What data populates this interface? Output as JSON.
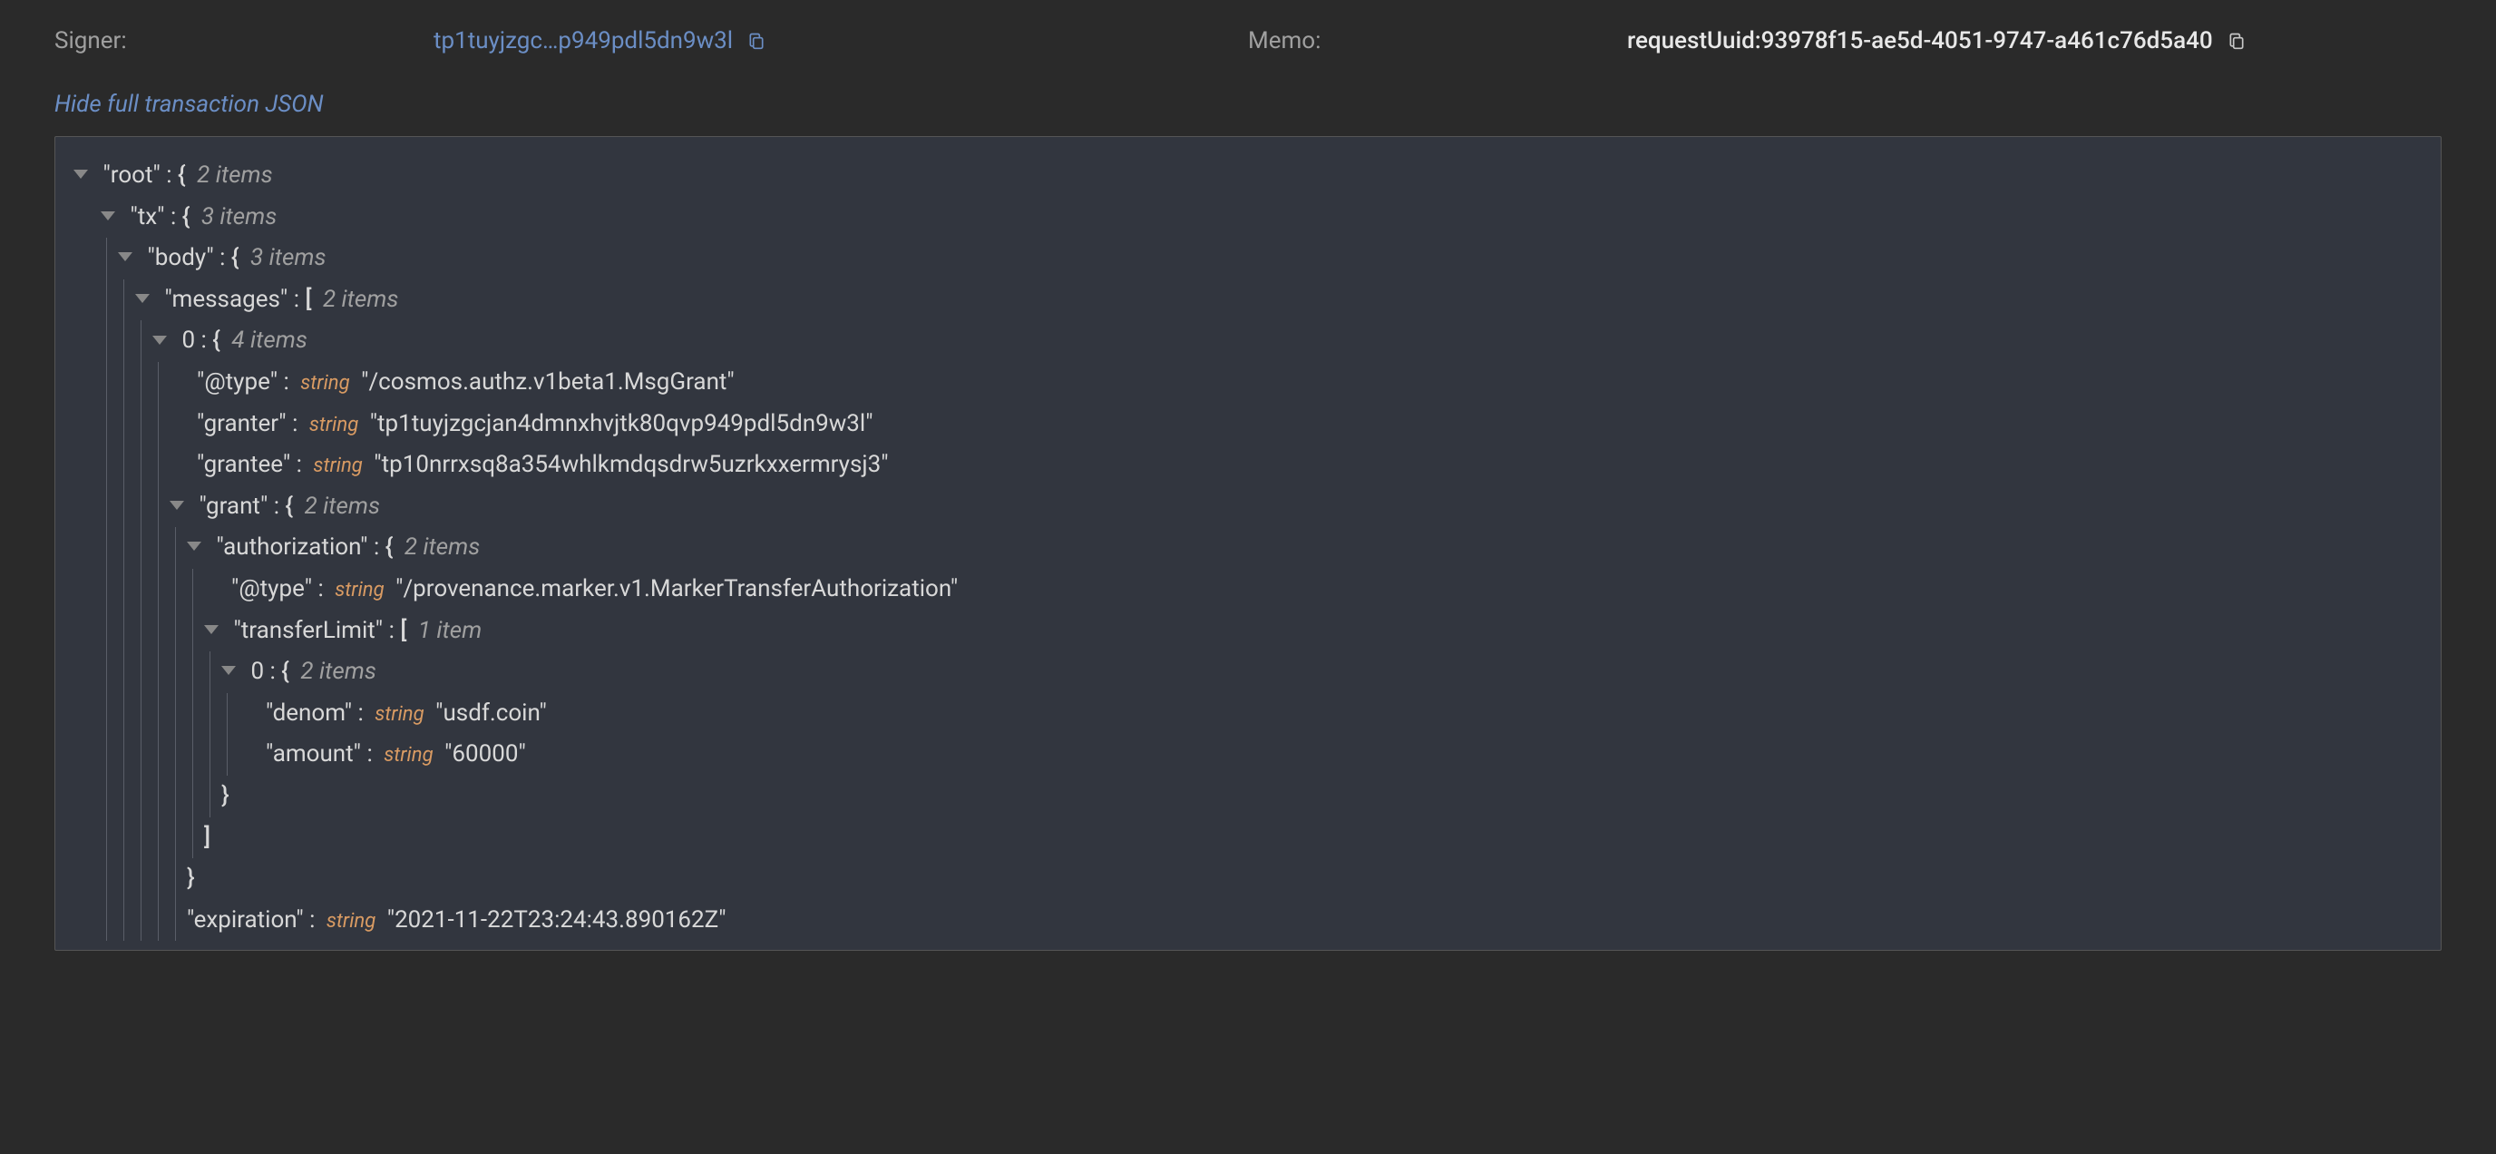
{
  "header": {
    "signer_label": "Signer:",
    "signer_value": "tp1tuyjzgc…p949pdl5dn9w3l",
    "memo_label": "Memo:",
    "memo_value": "requestUuid:93978f15-ae5d-4051-9747-a461c76d5a40"
  },
  "toggle": {
    "hide_label": "Hide full transaction JSON"
  },
  "json": {
    "root_key": "\"root\"",
    "root_meta": "2 items",
    "tx_key": "\"tx\"",
    "tx_meta": "3 items",
    "body_key": "\"body\"",
    "body_meta": "3 items",
    "messages_key": "\"messages\"",
    "messages_meta": "2 items",
    "msg0_key": "0",
    "msg0_meta": "4 items",
    "atype_key": "\"@type\"",
    "atype_type": "string",
    "atype_val": "\"/cosmos.authz.v1beta1.MsgGrant\"",
    "granter_key": "\"granter\"",
    "granter_type": "string",
    "granter_val": "\"tp1tuyjzgcjan4dmnxhvjtk80qvp949pdl5dn9w3l\"",
    "grantee_key": "\"grantee\"",
    "grantee_type": "string",
    "grantee_val": "\"tp10nrrxsq8a354whlkmdqsdrw5uzrkxxermrysj3\"",
    "grant_key": "\"grant\"",
    "grant_meta": "2 items",
    "auth_key": "\"authorization\"",
    "auth_meta": "2 items",
    "auth_type_key": "\"@type\"",
    "auth_type_type": "string",
    "auth_type_val": "\"/provenance.marker.v1.MarkerTransferAuthorization\"",
    "tl_key": "\"transferLimit\"",
    "tl_meta": "1 item",
    "tl0_key": "0",
    "tl0_meta": "2 items",
    "denom_key": "\"denom\"",
    "denom_type": "string",
    "denom_val": "\"usdf.coin\"",
    "amount_key": "\"amount\"",
    "amount_type": "string",
    "amount_val": "\"60000\"",
    "exp_key": "\"expiration\"",
    "exp_type": "string",
    "exp_val": "\"2021-11-22T23:24:43.890162Z\"",
    "close_brace": "}",
    "close_bracket": "]",
    "open_brace": "{",
    "open_bracket": "[",
    "colon": " : "
  }
}
